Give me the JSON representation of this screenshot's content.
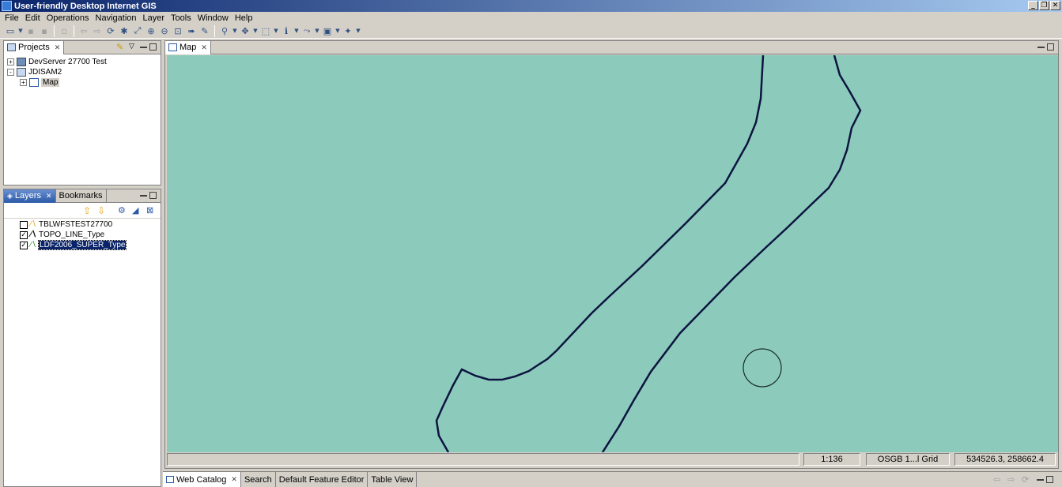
{
  "window": {
    "title": "User-friendly Desktop Internet GIS"
  },
  "menu": [
    "File",
    "Edit",
    "Operations",
    "Navigation",
    "Layer",
    "Tools",
    "Window",
    "Help"
  ],
  "projects_panel": {
    "tab_label": "Projects",
    "tree": [
      {
        "label": "DevServer 27700 Test",
        "level": 0,
        "expander": "+",
        "icon": "server-icon"
      },
      {
        "label": "JDISAM2",
        "level": 0,
        "expander": "-",
        "icon": "project-icon"
      },
      {
        "label": "Map",
        "level": 1,
        "expander": "+",
        "icon": "map-icon",
        "highlighted": true
      }
    ]
  },
  "layers_panel": {
    "tabs": [
      "Layers",
      "Bookmarks"
    ],
    "layers": [
      {
        "label": "TBLWFSTEST27700",
        "checked": false,
        "selected": false
      },
      {
        "label": "TOPO_LINE_Type",
        "checked": true,
        "selected": false
      },
      {
        "label": "LDF2006_SUPER_Type",
        "checked": true,
        "selected": true
      }
    ]
  },
  "map_editor": {
    "tab_label": "Map"
  },
  "status": {
    "scale": "1:136",
    "crs": "OSGB 1...l Grid",
    "coords": "534526.3, 258662.4"
  },
  "bottom_tabs": [
    "Web Catalog",
    "Search",
    "Default Feature Editor",
    "Table View"
  ],
  "colors": {
    "map_background": "#8ccbbb",
    "feature_line": "#0d1440",
    "title_gradient_start": "#0a246a"
  }
}
